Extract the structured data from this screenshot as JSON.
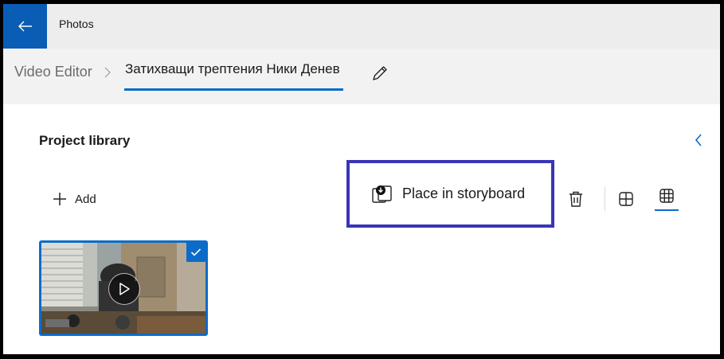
{
  "app": {
    "title": "Photos"
  },
  "breadcrumb": {
    "root": "Video Editor",
    "current": "Затихващи трептения Ники Денев"
  },
  "library": {
    "title": "Project library",
    "add_label": "Add",
    "place_label": "Place in storyboard",
    "items": [
      {
        "selected": true
      }
    ]
  },
  "icons": {
    "back": "back-arrow-icon",
    "chevron": "chevron-right-icon",
    "edit": "pencil-icon",
    "collapse": "chevron-left-icon",
    "add": "plus-icon",
    "place": "place-in-storyboard-icon",
    "delete": "trash-icon",
    "large_grid": "large-grid-icon",
    "small_grid": "small-grid-icon",
    "check": "checkmark-icon",
    "play": "play-icon"
  },
  "colors": {
    "accent": "#0a6cc8",
    "titlebar_back": "#0a5db5",
    "highlight_box": "#3a35b5"
  }
}
